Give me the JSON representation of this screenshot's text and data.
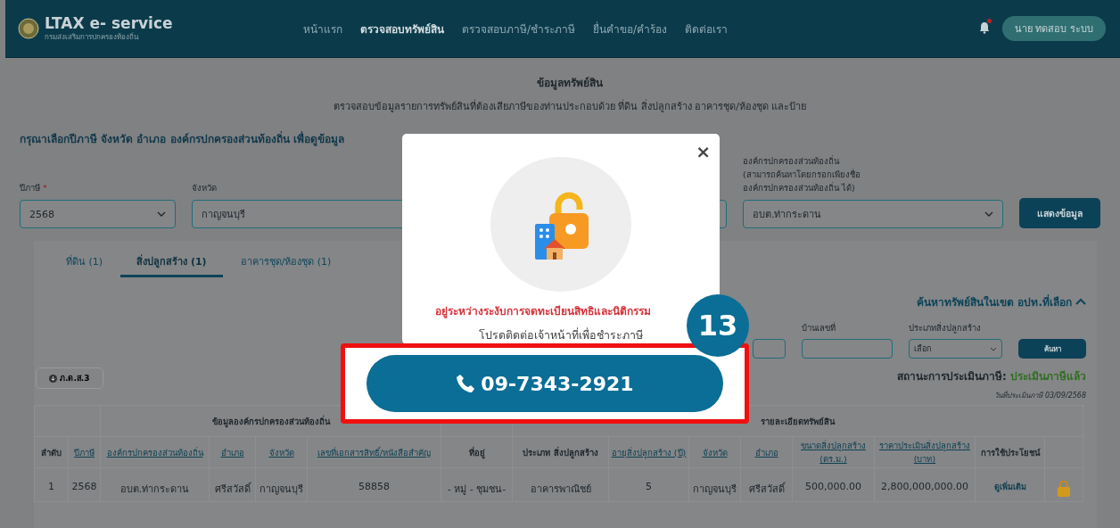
{
  "header": {
    "logo_title": "LTAX e- service",
    "logo_subtitle": "กรมส่งเสริมการปกครองท้องถิ่น",
    "nav": [
      {
        "label": "หน้าแรก",
        "selected": false
      },
      {
        "label": "ตรวจสอบทรัพย์สิน",
        "selected": true
      },
      {
        "label": "ตรวจสอบภาษี/ชำระภาษี",
        "selected": false
      },
      {
        "label": "ยื่นคำขอ/คำร้อง",
        "selected": false
      },
      {
        "label": "ติดต่อเรา",
        "selected": false
      }
    ],
    "notification_dot": true,
    "user_button": "นาย ทดสอบ ระบบ"
  },
  "page": {
    "title": "ข้อมูลทรัพย์สิน",
    "subtitle": "ตรวจสอบข้อมูลรายการทรัพย์สินที่ต้องเสียภาษีของท่านประกอบด้วย ที่ดิน สิ่งปลูกสร้าง อาคารชุด/ห้องชุด และป้าย",
    "instruction": "กรุณาเลือกปีภาษี จังหวัด อำเภอ องค์กรปกครองส่วนท้องถิ่น เพื่อดูข้อมูล"
  },
  "filters": {
    "fields": [
      {
        "label_lines": [
          "ปีภาษี"
        ],
        "required_mark": "*",
        "value": "2568",
        "kind": "select"
      },
      {
        "label_lines": [
          "จังหวัด"
        ],
        "value": "กาญจนบุรี",
        "kind": "text"
      },
      {
        "label_lines": [
          "องค์กรปกครองส่วนท้องถิ่น",
          "(สามารถค้นหาโดยกรอกเพียงชื่อ",
          "องค์กรปกครองส่วนท้องถิ่น ได้)"
        ],
        "value": "อบต.ท่ากระดาน",
        "kind": "select"
      }
    ],
    "submit": "แสดงข้อมูล"
  },
  "card": {
    "tabs": [
      {
        "label": "ที่ดิน (1)",
        "selected": false
      },
      {
        "label": "สิ่งปลูกสร้าง (1)",
        "selected": true
      },
      {
        "label": "อาคารชุด/ห้องชุด (1)",
        "selected": false
      }
    ],
    "search_toggle": {
      "label": "ค้นหาทรัพย์สินในเขต อปท.ที่เลือก",
      "expanded": true
    },
    "search_fields": [
      {
        "kind": "text"
      },
      {
        "label": "บ้านเลขที่",
        "kind": "text"
      },
      {
        "label": "ประเภทสิ่งปลูกสร้าง",
        "value": "เลือก",
        "kind": "select"
      }
    ],
    "search_button": "ค้นหา",
    "pdf_button": "ภ.ด.ส.3",
    "status_label": "สถานะการประเมินภาษี:",
    "status_value": "ประเมินภาษีแล้ว",
    "assessed_date": "วันที่ประเมินภาษี 03/09/2568",
    "table": {
      "groups": [
        "ข้อมูลองค์กรปกครองส่วนท้องถิ่น",
        "รายละเอียดทรัพย์สิน"
      ],
      "columns": [
        {
          "label": "ลำดับ",
          "sortable": false
        },
        {
          "label": "ปีภาษี",
          "sortable": true
        },
        {
          "label": "องค์กรปกครองส่วนท้องถิ่น",
          "sortable": true
        },
        {
          "label": "อำเภอ",
          "sortable": true
        },
        {
          "label": "จังหวัด",
          "sortable": true
        },
        {
          "label": "เลขที่เอกสารสิทธิ์/หนังสือสำคัญ",
          "sortable": true
        },
        {
          "label": "ที่อยู่",
          "sortable": false
        },
        {
          "label": "ประเภท สิ่งปลูกสร้าง",
          "sortable": false
        },
        {
          "label": "อายุสิ่งปลูกสร้าง (ปี)",
          "sortable": true
        },
        {
          "label": "จังหวัด",
          "sortable": true
        },
        {
          "label": "อำเภอ",
          "sortable": true
        },
        {
          "label": "ขนาดสิ่งปลูกสร้าง (ตร.ม.)",
          "sortable": true
        },
        {
          "label": "ราคาประเมินสิ่งปลูกสร้าง (บาท)",
          "sortable": true
        },
        {
          "label": "การใช้ประโยชน์",
          "sortable": false
        }
      ],
      "rows": [
        {
          "cells": [
            "1",
            "2568",
            "อบต.ท่ากระดาน",
            "ศรีสวัสดิ์",
            "กาญจนบุรี",
            "58858",
            "- หมู่ - ชุมชน-",
            "อาคารพาณิชย์",
            "5",
            "กาญจนบุรี",
            "ศรีสวัสดิ์",
            "500,000.00",
            "2,800,000,000.00"
          ],
          "action": "ดูเพิ่มเติม",
          "locked": true
        }
      ]
    }
  },
  "modal": {
    "close": "×",
    "message": "อยู่ระหว่างระงับการจดทะเบียนสิทธิและนิติกรรม",
    "hint": "โปรดติดต่อเจ้าหน้าที่เพื่อชำระภาษี",
    "phone": "09-7343-2921"
  },
  "annotation": {
    "step": "13"
  }
}
